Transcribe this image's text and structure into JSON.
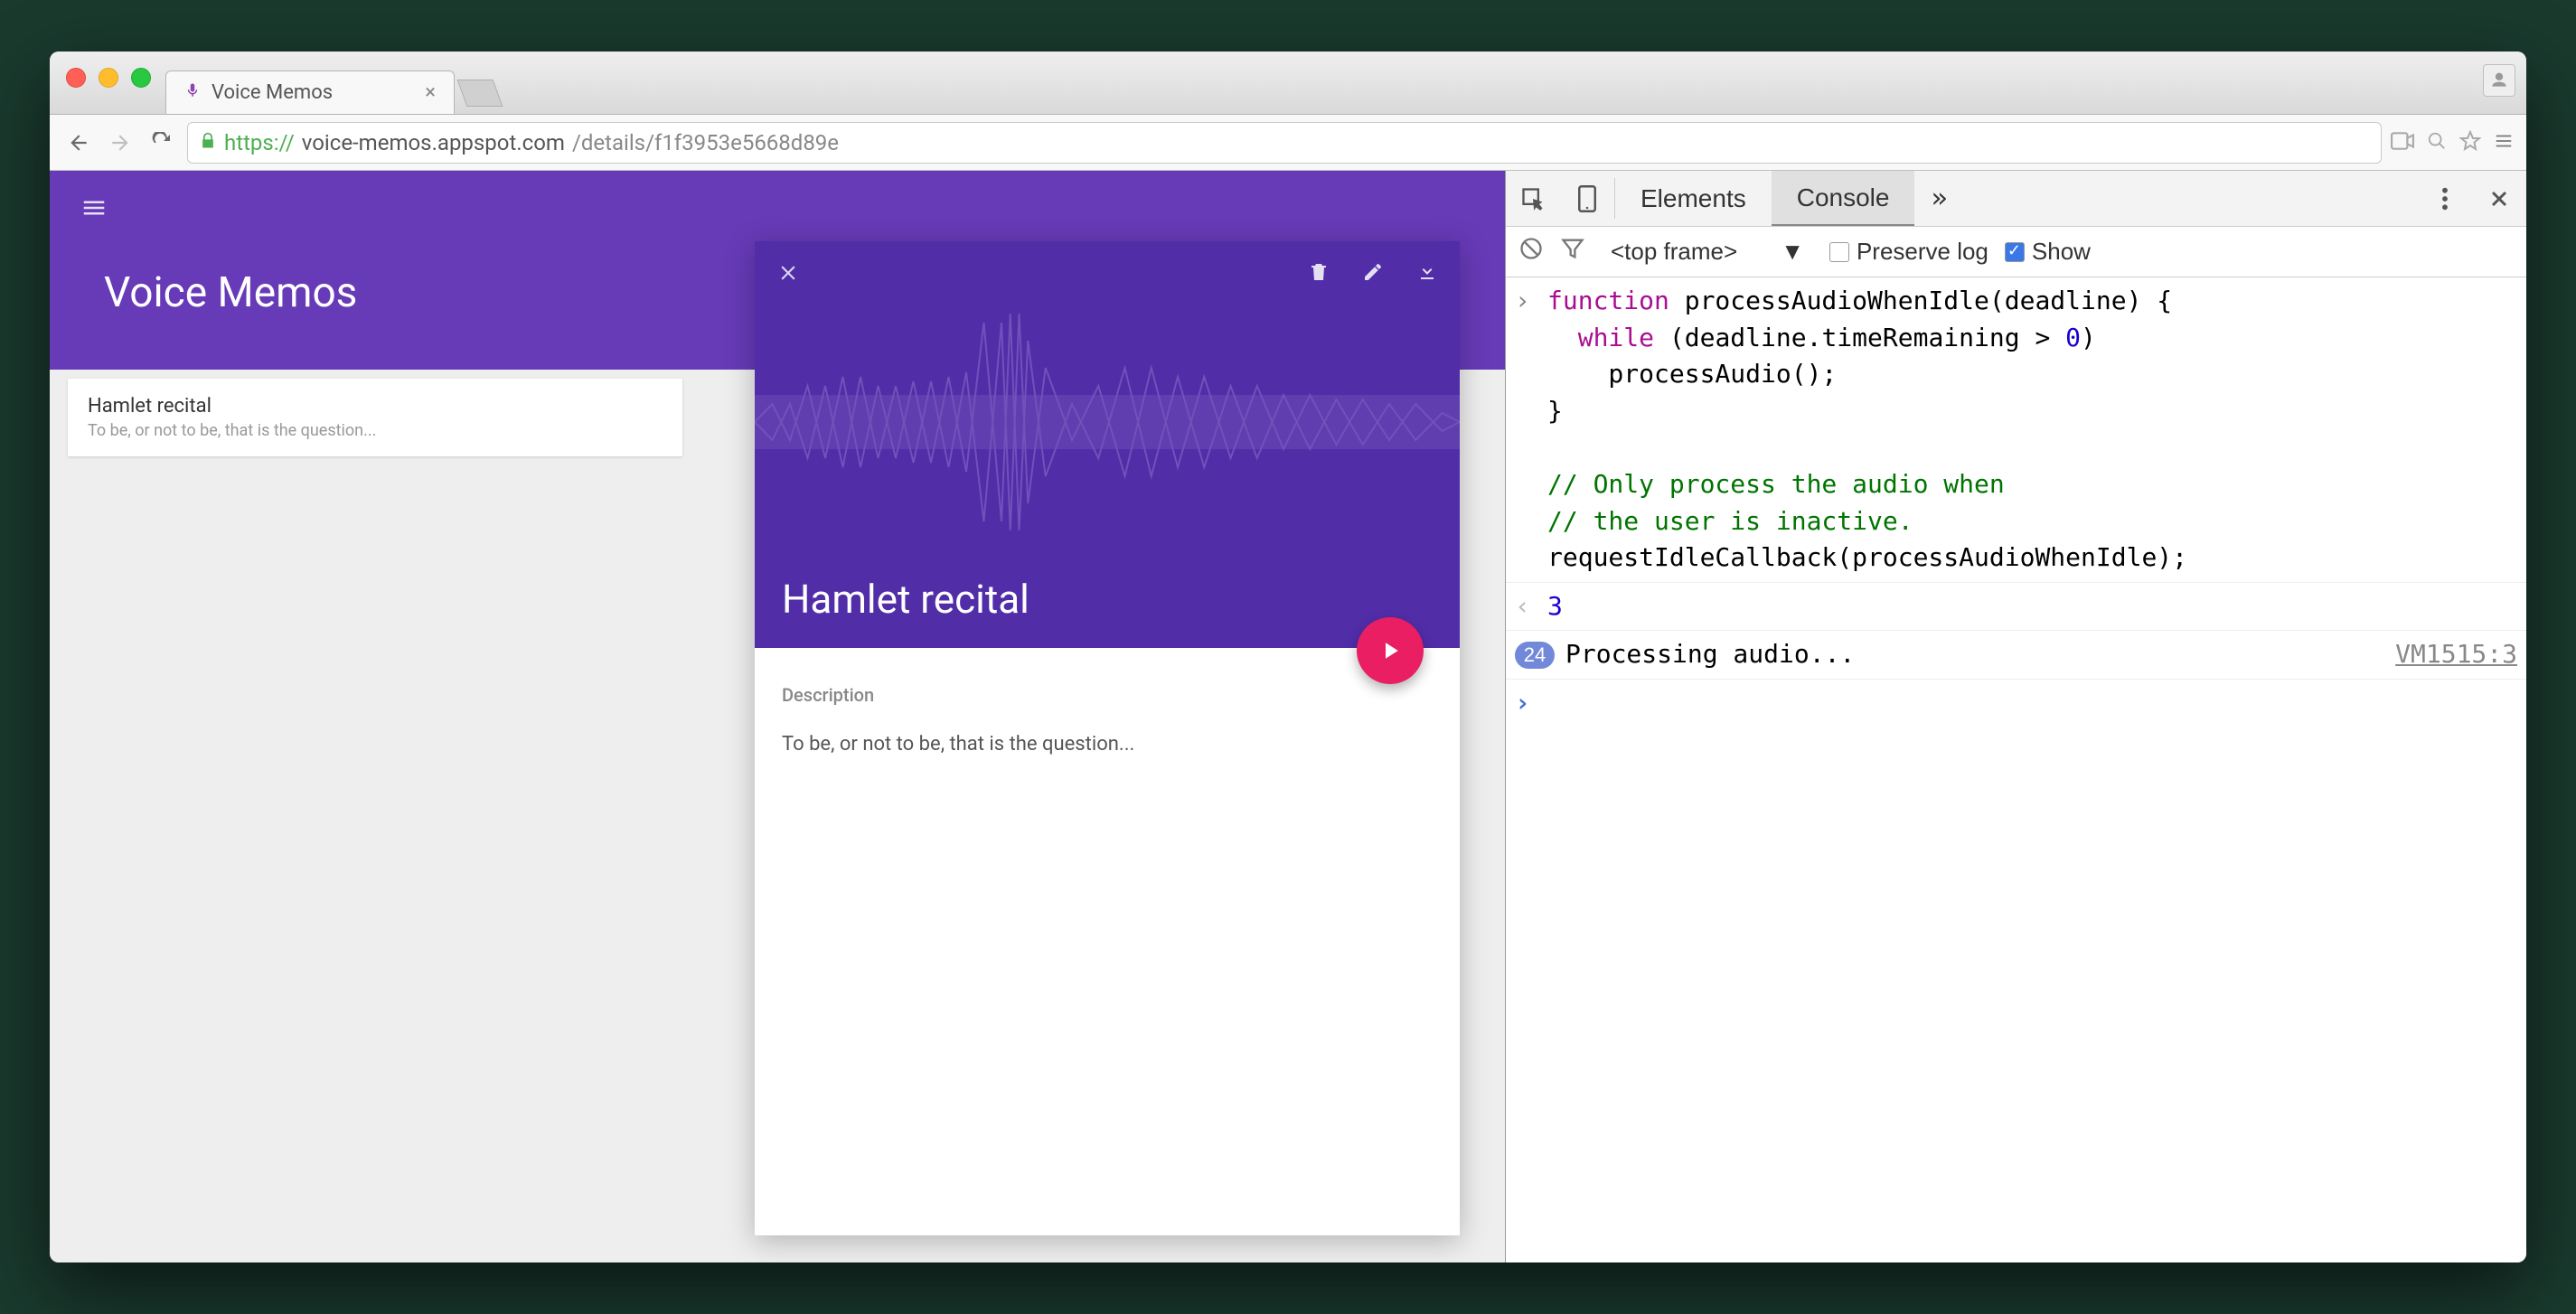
{
  "browser_tab": {
    "title": "Voice Memos"
  },
  "url": {
    "scheme": "https://",
    "host": "voice-memos.appspot.com",
    "path": "/details/f1f3953e5668d89e"
  },
  "app": {
    "title": "Voice Memos",
    "memo_list": [
      {
        "title": "Hamlet recital",
        "subtitle": "To be, or not to be, that is the question..."
      }
    ],
    "detail": {
      "title": "Hamlet recital",
      "description_label": "Description",
      "description": "To be, or not to be, that is the question..."
    }
  },
  "devtools": {
    "tabs": {
      "elements": "Elements",
      "console": "Console"
    },
    "context": "<top frame>",
    "preserve_log_label": "Preserve log",
    "show_label": "Show",
    "code": "function processAudioWhenIdle(deadline) {\n  while (deadline.timeRemaining > 0)\n    processAudio();\n}\n\n// Only process the audio when\n// the user is inactive.\nrequestIdleCallback(processAudioWhenIdle);",
    "return_value": "3",
    "log": {
      "count": "24",
      "message": "Processing audio...",
      "source": "VM1515:3"
    }
  }
}
